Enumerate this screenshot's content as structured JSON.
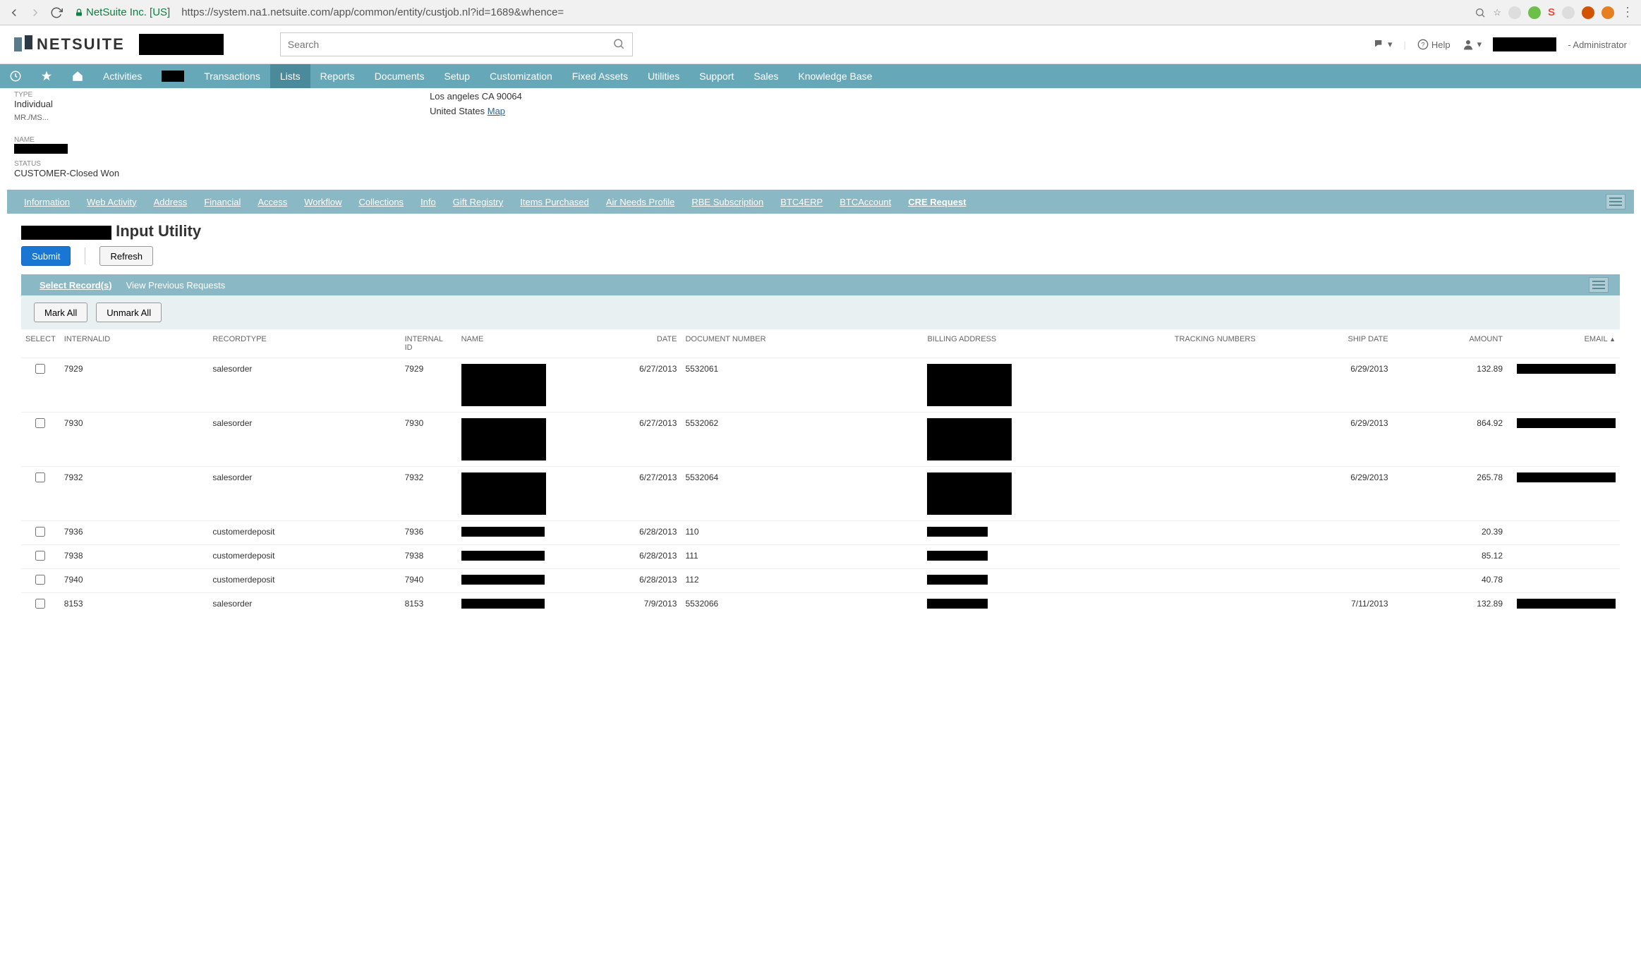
{
  "browser": {
    "site": "NetSuite Inc. [US]",
    "url": "https://system.na1.netsuite.com/app/common/entity/custjob.nl?id=1689&whence="
  },
  "header": {
    "logo_text": "NETSUITE",
    "search_placeholder": "Search",
    "help_label": "Help",
    "role_suffix": "- Administrator"
  },
  "nav": {
    "items": [
      "Activities",
      "",
      "Transactions",
      "Lists",
      "Reports",
      "Documents",
      "Setup",
      "Customization",
      "Fixed Assets",
      "Utilities",
      "Support",
      "Sales",
      "Knowledge Base"
    ],
    "active_index": 3
  },
  "record": {
    "type_label": "TYPE",
    "type_value": "Individual",
    "title_prefix": "MR./MS...",
    "name_label": "NAME",
    "status_label": "STATUS",
    "status_value": "CUSTOMER-Closed Won",
    "address_line1": "Los angeles CA 90064",
    "address_line2": "United States",
    "map_link": "Map"
  },
  "subtabs": [
    "Information",
    "Web Activity",
    "Address",
    "Financial",
    "Access",
    "Workflow",
    "Collections",
    "Info",
    "Gift Registry",
    "Items Purchased",
    "Air Needs Profile",
    "RBE Subscription",
    "BTC4ERP",
    "BTCAccount",
    "CRE Request"
  ],
  "subtabs_active_index": 14,
  "page_title_suffix": " Input Utility",
  "buttons": {
    "submit": "Submit",
    "refresh": "Refresh",
    "mark_all": "Mark All",
    "unmark_all": "Unmark All"
  },
  "section_tabs": {
    "select_records": "Select Record(s)",
    "view_previous": "View Previous Requests"
  },
  "table": {
    "headers": {
      "select": "SELECT",
      "internalid": "INTERNALID",
      "recordtype": "RECORDTYPE",
      "internal_id": "INTERNAL ID",
      "name": "NAME",
      "date": "DATE",
      "document_number": "DOCUMENT NUMBER",
      "billing_address": "BILLING ADDRESS",
      "tracking_numbers": "TRACKING NUMBERS",
      "ship_date": "SHIP DATE",
      "amount": "AMOUNT",
      "email": "EMAIL"
    },
    "rows": [
      {
        "internalid": "7929",
        "recordtype": "salesorder",
        "internal_id": "7929",
        "date": "6/27/2013",
        "docnum": "5532061",
        "shipdate": "6/29/2013",
        "amount": "132.89",
        "tall": true,
        "email_redact": true
      },
      {
        "internalid": "7930",
        "recordtype": "salesorder",
        "internal_id": "7930",
        "date": "6/27/2013",
        "docnum": "5532062",
        "shipdate": "6/29/2013",
        "amount": "864.92",
        "tall": true,
        "email_redact": true
      },
      {
        "internalid": "7932",
        "recordtype": "salesorder",
        "internal_id": "7932",
        "date": "6/27/2013",
        "docnum": "5532064",
        "shipdate": "6/29/2013",
        "amount": "265.78",
        "tall": true,
        "email_redact": true
      },
      {
        "internalid": "7936",
        "recordtype": "customerdeposit",
        "internal_id": "7936",
        "date": "6/28/2013",
        "docnum": "110",
        "shipdate": "",
        "amount": "20.39",
        "tall": false,
        "email_redact": false
      },
      {
        "internalid": "7938",
        "recordtype": "customerdeposit",
        "internal_id": "7938",
        "date": "6/28/2013",
        "docnum": "111",
        "shipdate": "",
        "amount": "85.12",
        "tall": false,
        "email_redact": false
      },
      {
        "internalid": "7940",
        "recordtype": "customerdeposit",
        "internal_id": "7940",
        "date": "6/28/2013",
        "docnum": "112",
        "shipdate": "",
        "amount": "40.78",
        "tall": false,
        "email_redact": false
      },
      {
        "internalid": "8153",
        "recordtype": "salesorder",
        "internal_id": "8153",
        "date": "7/9/2013",
        "docnum": "5532066",
        "shipdate": "7/11/2013",
        "amount": "132.89",
        "tall": false,
        "email_redact": true
      }
    ]
  }
}
